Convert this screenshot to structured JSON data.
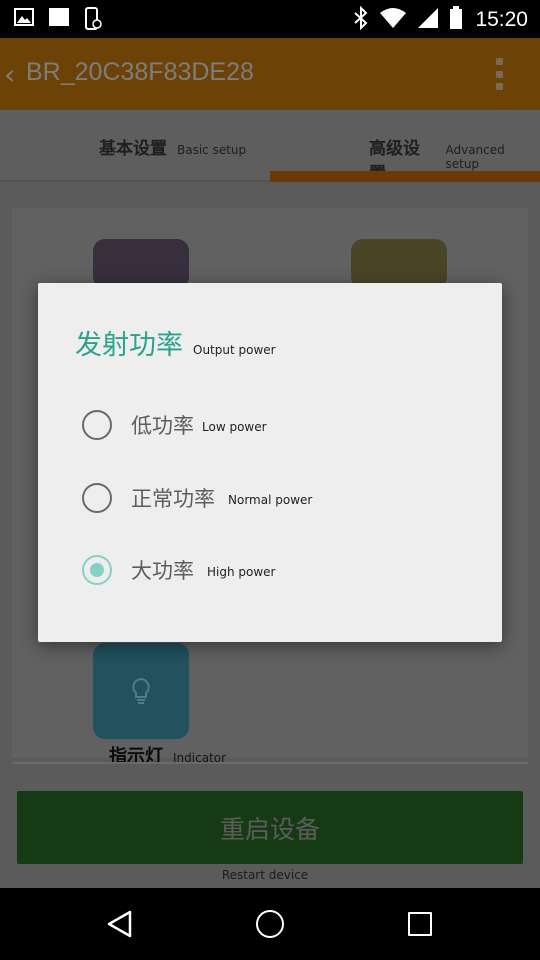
{
  "status_bar": {
    "time": "15:20",
    "icons": [
      "image-icon",
      "square-icon",
      "phone-security-icon",
      "bluetooth-icon",
      "wifi-icon",
      "signal-icon",
      "battery-icon"
    ]
  },
  "app_bar": {
    "title": "BR_20C38F83DE28",
    "back_icon": "‹",
    "menu_icon": "overflow-menu-icon"
  },
  "tabs": [
    {
      "zh": "基本设置",
      "en": "Basic setup",
      "selected": false
    },
    {
      "zh": "高级设置",
      "en": "Advanced setup",
      "selected": true
    }
  ],
  "content": {
    "indicator_zh": "指示灯",
    "indicator_en": "Indicator",
    "restart_zh": "重启设备",
    "restart_en": "Restart device"
  },
  "dialog": {
    "title_zh": "发射功率",
    "title_en": "Output power",
    "options": [
      {
        "zh": "低功率",
        "en": "Low power",
        "checked": false
      },
      {
        "zh": "正常功率",
        "en": "Normal power",
        "checked": false
      },
      {
        "zh": "大功率",
        "en": "High power",
        "checked": true
      }
    ],
    "accent_color": "#2aa38c",
    "radio_checked_color": "#84d1c5"
  },
  "colors": {
    "app_bar": "#6d4207",
    "restart_button": "#163b14"
  }
}
